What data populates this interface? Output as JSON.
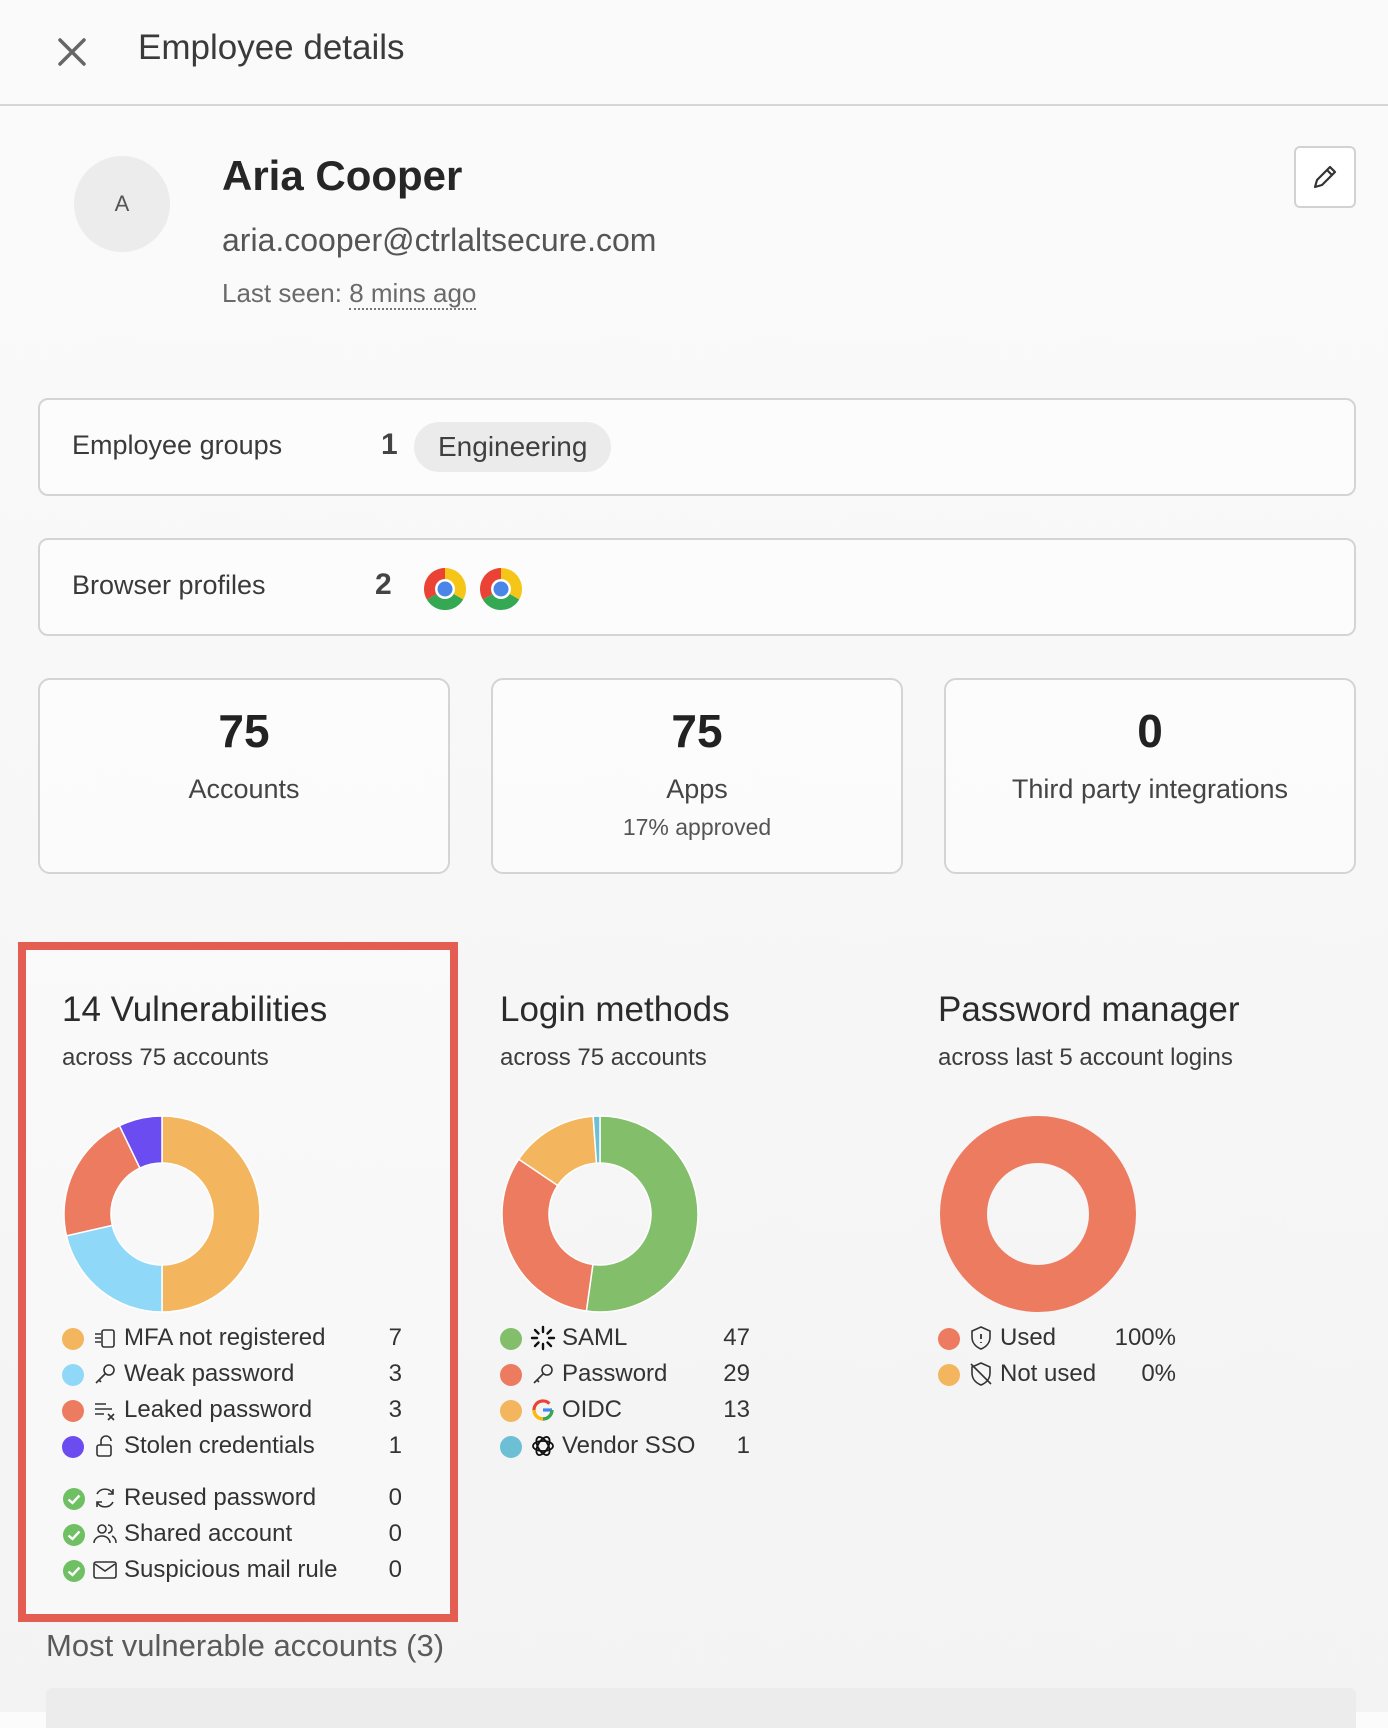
{
  "header": {
    "title": "Employee details",
    "close_icon": "close-icon"
  },
  "profile": {
    "avatar_initial": "A",
    "name": "Aria Cooper",
    "email": "aria.cooper@ctrlaltsecure.com",
    "last_seen_label": "Last seen: ",
    "last_seen_value": "8 mins ago",
    "edit_icon": "pencil-icon"
  },
  "employee_groups": {
    "label": "Employee groups",
    "count": "1",
    "groups": [
      "Engineering"
    ]
  },
  "browser_profiles": {
    "label": "Browser profiles",
    "count": "2",
    "icons": [
      "chrome-icon",
      "chrome-icon"
    ]
  },
  "stats": [
    {
      "value": "75",
      "label": "Accounts",
      "sub": ""
    },
    {
      "value": "75",
      "label": "Apps",
      "sub": "17% approved"
    },
    {
      "value": "0",
      "label": "Third party integrations",
      "sub": ""
    }
  ],
  "vulnerabilities": {
    "title": "14 Vulnerabilities",
    "subtitle": "across 75 accounts",
    "items": [
      {
        "label": "MFA not registered",
        "value": "7",
        "color": "#f3b65e",
        "icon": "mfa-device-icon"
      },
      {
        "label": "Weak password",
        "value": "3",
        "color": "#8fd8f8",
        "icon": "key-icon"
      },
      {
        "label": "Leaked password",
        "value": "3",
        "color": "#ec7b5f",
        "icon": "leak-icon"
      },
      {
        "label": "Stolen credentials",
        "value": "1",
        "color": "#6a4cf0",
        "icon": "unlock-icon"
      }
    ],
    "ok_items": [
      {
        "label": "Reused password",
        "value": "0",
        "icon": "refresh-icon"
      },
      {
        "label": "Shared account",
        "value": "0",
        "icon": "users-icon"
      },
      {
        "label": "Suspicious mail rule",
        "value": "0",
        "icon": "mail-icon"
      }
    ]
  },
  "login_methods": {
    "title": "Login methods",
    "subtitle": "across 75 accounts",
    "items": [
      {
        "label": "SAML",
        "value": "47",
        "color": "#83be6b",
        "icon": "saml-icon"
      },
      {
        "label": "Password",
        "value": "29",
        "color": "#ec7b5f",
        "icon": "key-icon"
      },
      {
        "label": "OIDC",
        "value": "13",
        "color": "#f3b65e",
        "icon": "google-icon"
      },
      {
        "label": "Vendor SSO",
        "value": "1",
        "color": "#6cbfd4",
        "icon": "openai-icon"
      }
    ]
  },
  "password_manager": {
    "title": "Password manager",
    "subtitle": "across last 5 account logins",
    "items": [
      {
        "label": "Used",
        "value": "100%",
        "color": "#ec7b5f",
        "icon": "shield-icon"
      },
      {
        "label": "Not used",
        "value": "0%",
        "color": "#f3b65e",
        "icon": "shield-off-icon"
      }
    ]
  },
  "chart_data": [
    {
      "type": "pie",
      "title": "14 Vulnerabilities",
      "categories": [
        "MFA not registered",
        "Weak password",
        "Leaked password",
        "Stolen credentials"
      ],
      "values": [
        7,
        3,
        3,
        1
      ],
      "colors": [
        "#f3b65e",
        "#8fd8f8",
        "#ec7b5f",
        "#6a4cf0"
      ],
      "donut": true
    },
    {
      "type": "pie",
      "title": "Login methods",
      "categories": [
        "SAML",
        "Password",
        "OIDC",
        "Vendor SSO"
      ],
      "values": [
        47,
        29,
        13,
        1
      ],
      "colors": [
        "#83be6b",
        "#ec7b5f",
        "#f3b65e",
        "#6cbfd4"
      ],
      "donut": true
    },
    {
      "type": "pie",
      "title": "Password manager",
      "categories": [
        "Used",
        "Not used"
      ],
      "values": [
        100,
        0
      ],
      "colors": [
        "#ec7b5f",
        "#f3b65e"
      ],
      "donut": true
    }
  ],
  "most_vulnerable": {
    "title": "Most vulnerable accounts (3)"
  }
}
